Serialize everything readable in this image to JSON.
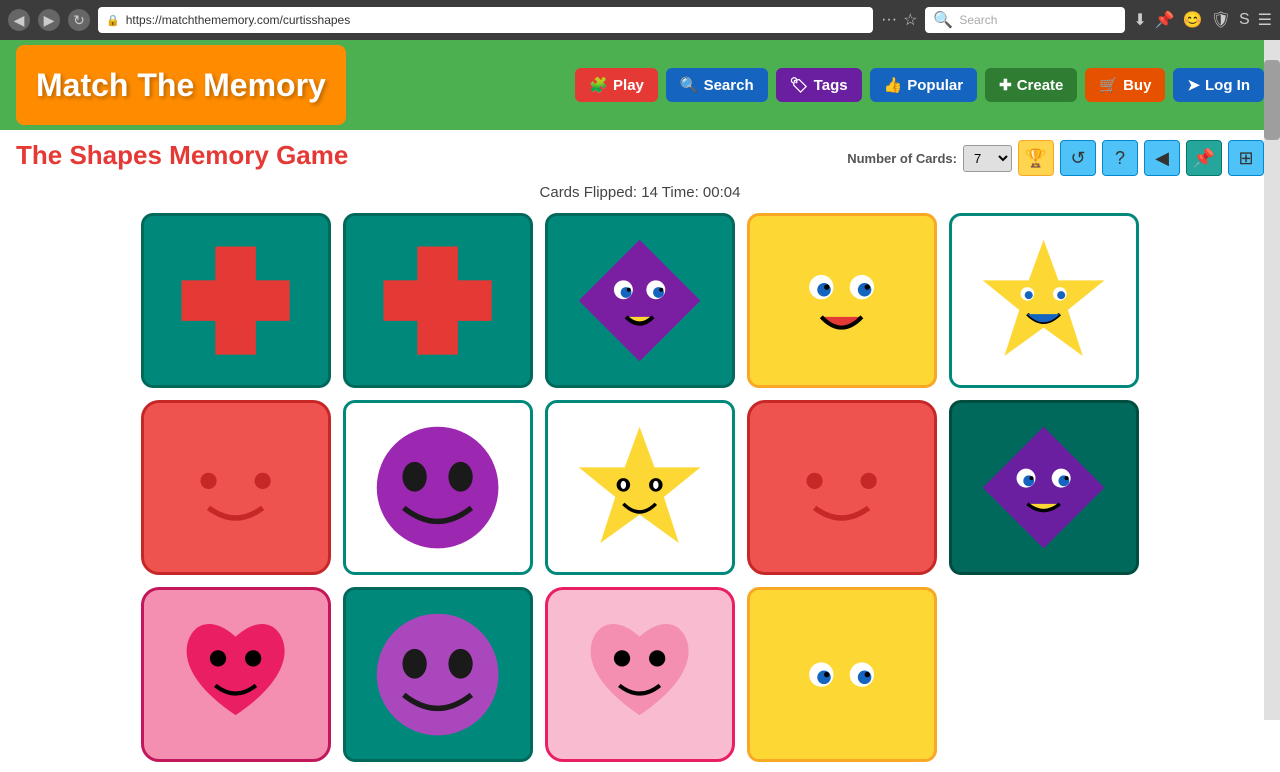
{
  "browser": {
    "url": "https://matchthememory.com/curtisshapes",
    "search_placeholder": "Search",
    "nav_back": "◀",
    "nav_forward": "▶",
    "nav_refresh": "↻"
  },
  "header": {
    "logo": "Match The Memory",
    "nav": [
      {
        "label": "Play",
        "icon": "🧩",
        "class": "btn-play"
      },
      {
        "label": "Search",
        "icon": "🔍",
        "class": "btn-search"
      },
      {
        "label": "Tags",
        "icon": "🏷",
        "class": "btn-tags"
      },
      {
        "label": "Popular",
        "icon": "👍",
        "class": "btn-popular"
      },
      {
        "label": "Create",
        "icon": "✚",
        "class": "btn-create"
      },
      {
        "label": "Buy",
        "icon": "🛒",
        "class": "btn-buy"
      },
      {
        "label": "Log In",
        "icon": "➤",
        "class": "btn-login"
      }
    ]
  },
  "game": {
    "title": "The Shapes Memory Game",
    "number_of_cards_label": "Number of Cards:",
    "number_of_cards_value": "7",
    "stats": "Cards Flipped: 14  Time: 00:04",
    "controls": [
      "🏆",
      "↺",
      "?",
      "◀",
      "📌",
      "⊞"
    ]
  }
}
